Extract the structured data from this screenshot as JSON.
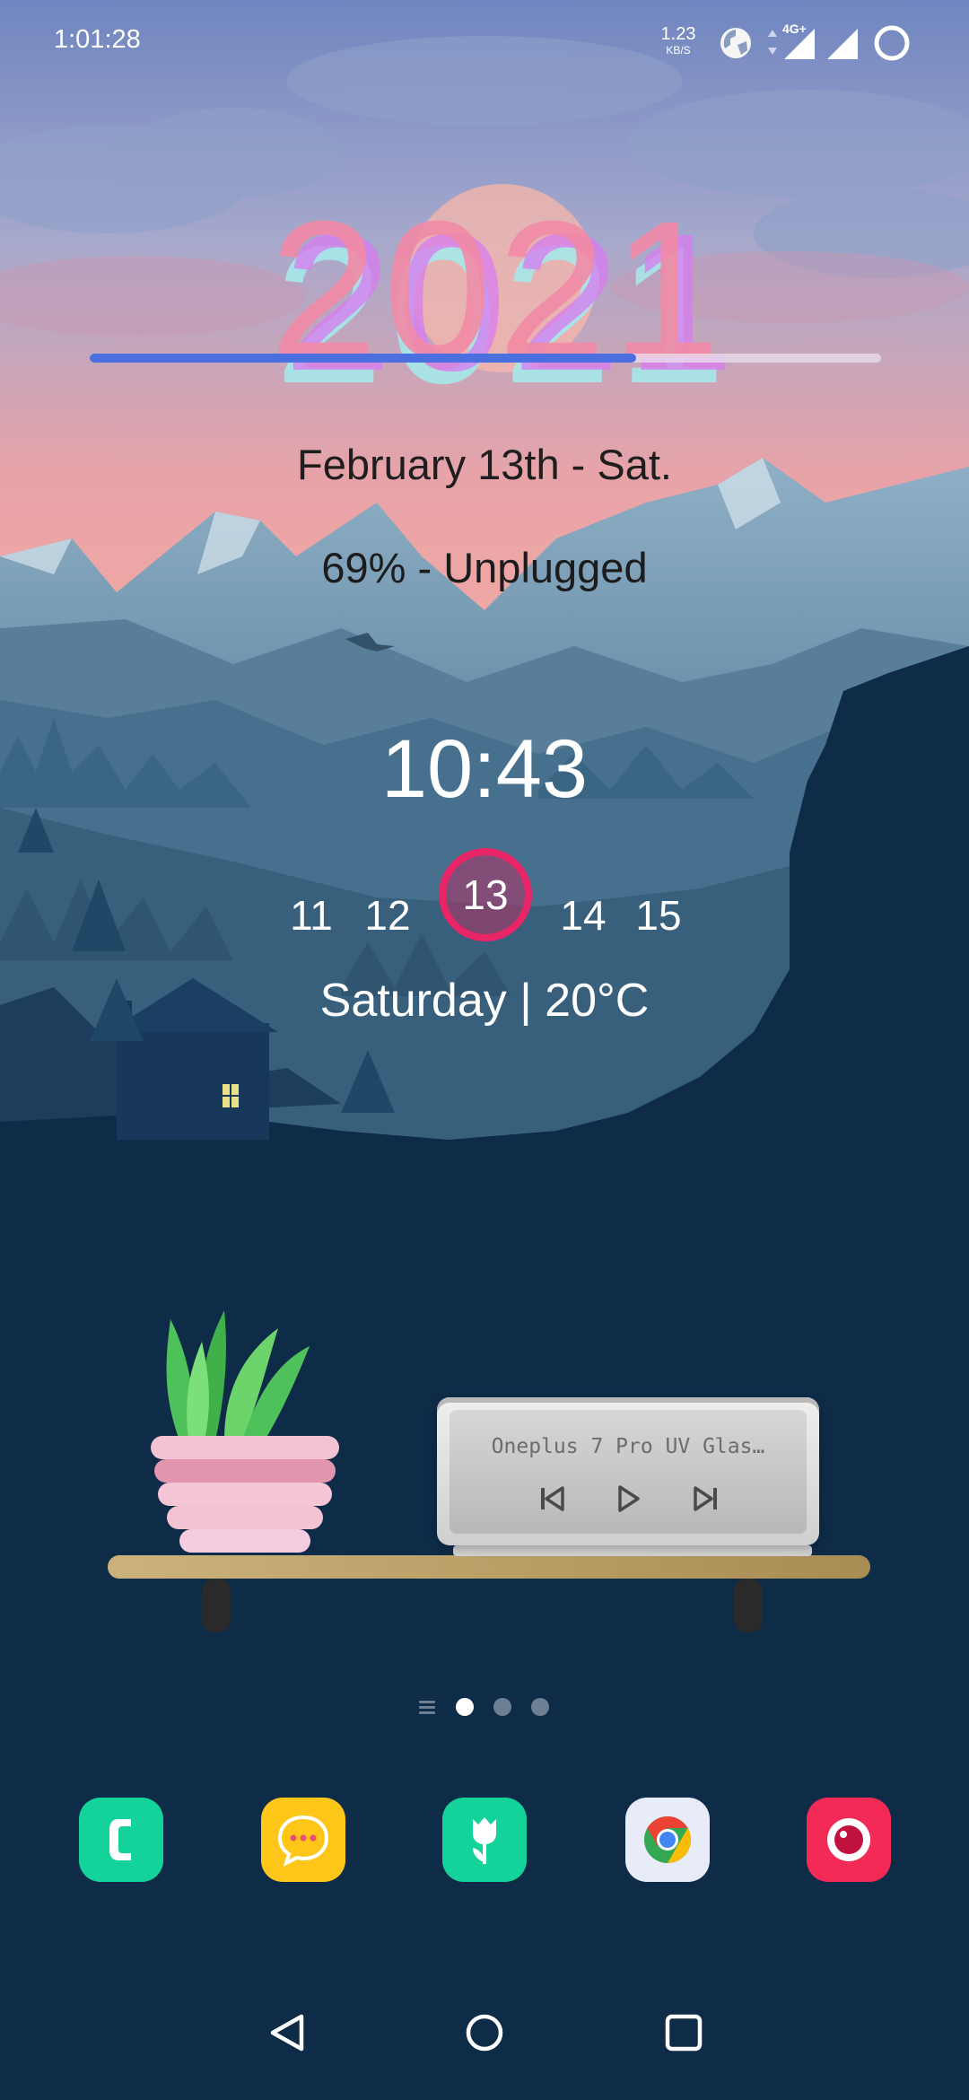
{
  "status_bar": {
    "time": "1:01:28",
    "net_speed_value": "1.23",
    "net_speed_unit": "KB/S",
    "network_type": "4G+",
    "icons": [
      "vpn-globe-icon",
      "data-arrows-icon",
      "signal-icon",
      "signal-icon",
      "battery-ring-icon"
    ]
  },
  "year_widget": {
    "year": "2021",
    "progress_fraction": 0.69,
    "colors": {
      "pink": "#f28aa6",
      "cyan": "#a6e8ea",
      "magenta": "#d97bf0",
      "bar": "#4c6fe0"
    }
  },
  "date_text": "February 13th - Sat.",
  "battery_text": "69% - Unplugged",
  "clock": "10:43",
  "calendar_strip": {
    "days": [
      "11",
      "12",
      "13",
      "14",
      "15"
    ],
    "selected": "13",
    "accent": "#e82566"
  },
  "weather_text": "Saturday | 20°C",
  "music_widget": {
    "track": "Oneplus 7 Pro UV Glas…",
    "buttons": [
      "previous-icon",
      "play-icon",
      "next-icon"
    ]
  },
  "home_pager": {
    "pages": 3,
    "current": 1
  },
  "dock": [
    {
      "name": "phone",
      "icon": "phone-icon",
      "color": "#13d39b"
    },
    {
      "name": "messages",
      "icon": "chat-bubble-icon",
      "color": "#ffc61a"
    },
    {
      "name": "florist",
      "icon": "tulip-icon",
      "color": "#13d39b"
    },
    {
      "name": "chrome",
      "icon": "chrome-icon",
      "color": "#e8ecf8"
    },
    {
      "name": "camera",
      "icon": "camera-lens-icon",
      "color": "#f22a55"
    }
  ],
  "nav_bar": [
    "back-icon",
    "home-icon",
    "recents-icon"
  ]
}
